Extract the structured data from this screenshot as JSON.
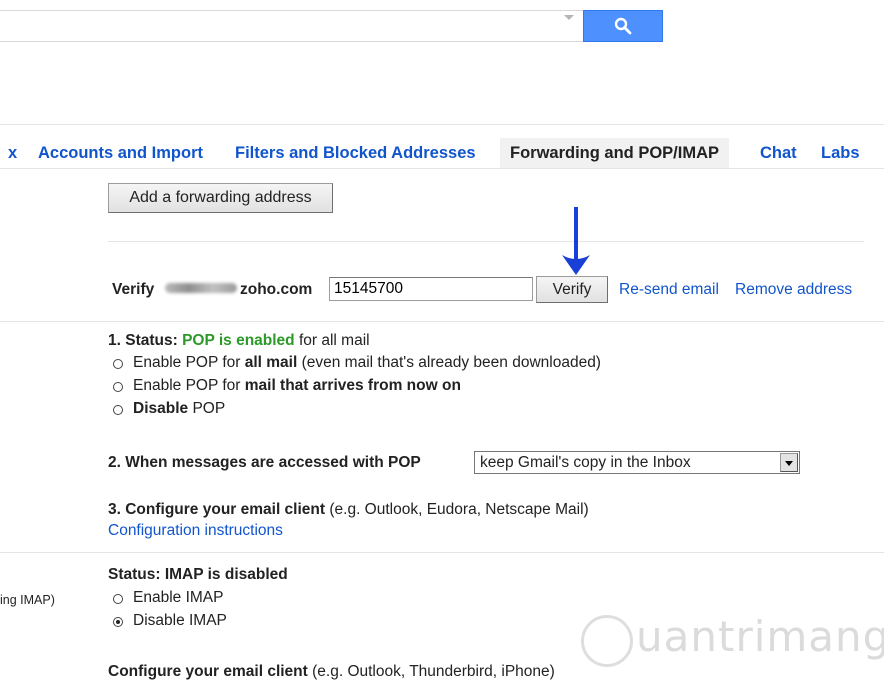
{
  "tabs": [
    {
      "label": "x"
    },
    {
      "label": "Accounts and Import"
    },
    {
      "label": "Filters and Blocked Addresses"
    },
    {
      "label": "Forwarding and POP/IMAP"
    },
    {
      "label": "Chat"
    },
    {
      "label": "Labs"
    }
  ],
  "forwarding": {
    "add_button": "Add a forwarding address",
    "verify_label": "Verify",
    "email_domain": "zoho.com",
    "code_value": "15145700",
    "verify_button": "Verify",
    "resend_link": "Re-send email",
    "remove_link": "Remove address"
  },
  "pop": {
    "status_prefix": "1. Status:",
    "status_value": "POP is enabled",
    "status_suffix": "for all mail",
    "options": [
      {
        "pre": "Enable POP for ",
        "bold": "all mail",
        "post": " (even mail that's already been downloaded)"
      },
      {
        "pre": "Enable POP for ",
        "bold": "mail that arrives from now on",
        "post": ""
      },
      {
        "pre": "",
        "bold": "Disable",
        "post": " POP"
      }
    ],
    "access_label": "2. When messages are accessed with POP",
    "access_value": "keep Gmail's copy in the Inbox",
    "config_label": "3. Configure your email client",
    "config_examples": "(e.g. Outlook, Eudora, Netscape Mail)",
    "config_link": "Configuration instructions"
  },
  "imap": {
    "side_note": "ing IMAP)",
    "status": "Status: IMAP is disabled",
    "enable": "Enable IMAP",
    "disable": "Disable IMAP",
    "config_label": "Configure your email client",
    "config_examples": "(e.g. Outlook, Thunderbird, iPhone)"
  },
  "watermark": "uantrimang",
  "icons": {
    "search": "search-icon",
    "arrow": "down-arrow-icon"
  },
  "colors": {
    "link": "#1155cc",
    "green": "#2c9a28",
    "search_blue": "#4d90fe",
    "arrow": "#1a3fd6"
  }
}
